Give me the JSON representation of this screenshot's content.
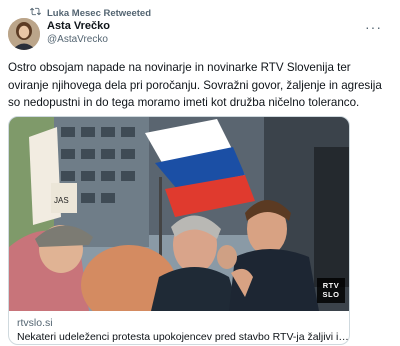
{
  "retweet": {
    "label": "Luka Mesec Retweeted",
    "icon": "retweet-icon"
  },
  "author": {
    "name": "Asta Vrečko",
    "handle": "@AstaVrecko"
  },
  "more_icon": "more-options-icon",
  "tweet": {
    "text": "Ostro obsojam napade na novinarje in novinarke RTV Slovenija ter oviranje njihovega dela pri poročanju. Sovražni govor, žaljenje in agresija so nedopustni in do tega moramo imeti kot družba ničelno toleranco."
  },
  "card": {
    "badge": "RTV SLO",
    "badge_line1": "RTV",
    "badge_line2": "SLO",
    "sign_text": "JAS",
    "domain": "rtvslo.si",
    "title": "Nekateri udeleženci protesta upokojencev pred stavbo RTV-ja žaljivi in agresivni do novinarjev"
  },
  "colors": {
    "text": "#0f1419",
    "muted": "#536471",
    "border": "#cfd9de"
  }
}
